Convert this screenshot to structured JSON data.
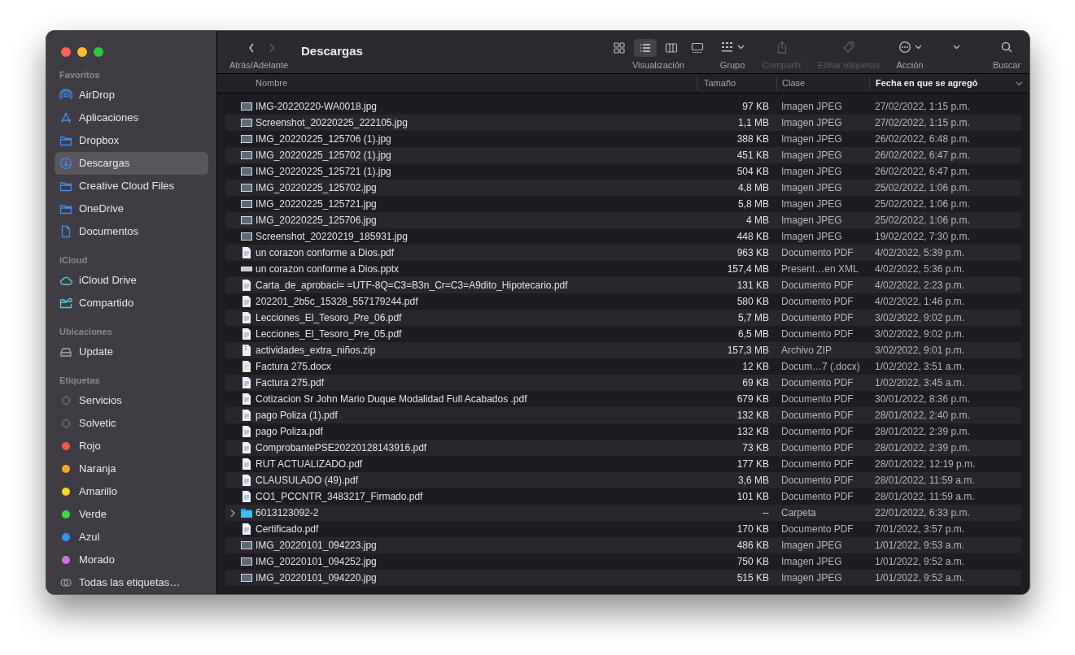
{
  "window": {
    "title": "Descargas"
  },
  "toolbar": {
    "back": {
      "disabled": false
    },
    "forward": {
      "disabled": true
    },
    "nav_label": "Atrás/Adelante",
    "views": [
      {
        "kind": "icons",
        "selected": false
      },
      {
        "kind": "list",
        "selected": true
      },
      {
        "kind": "columns",
        "selected": false
      },
      {
        "kind": "gallery",
        "selected": false
      }
    ],
    "views_label": "Visualización",
    "actions": [
      {
        "kind": "group",
        "label": "Grupo",
        "disabled": false
      },
      {
        "kind": "share",
        "label": "Compartir",
        "disabled": true
      },
      {
        "kind": "tags",
        "label": "Editar etiquetas",
        "disabled": true
      },
      {
        "kind": "action",
        "label": "Acción",
        "disabled": false
      },
      {
        "kind": "more",
        "disabled": false
      },
      {
        "kind": "search",
        "label": "Buscar",
        "disabled": false
      }
    ]
  },
  "sidebar": {
    "sections": [
      {
        "title": "Favoritos",
        "items": [
          {
            "kind": "airdrop",
            "label": "AirDrop",
            "selected": false
          },
          {
            "kind": "apps",
            "label": "Aplicaciones",
            "selected": false
          },
          {
            "kind": "folder",
            "label": "Dropbox",
            "selected": false
          },
          {
            "kind": "download",
            "label": "Descargas",
            "selected": true
          },
          {
            "kind": "folder",
            "label": "Creative Cloud Files",
            "selected": false
          },
          {
            "kind": "folder",
            "label": "OneDrive",
            "selected": false
          },
          {
            "kind": "document",
            "label": "Documentos",
            "selected": false
          }
        ]
      },
      {
        "title": "iCloud",
        "items": [
          {
            "kind": "cloud",
            "label": "iCloud Drive",
            "selected": false
          },
          {
            "kind": "shared",
            "label": "Compartido",
            "selected": false
          }
        ]
      },
      {
        "title": "Ubicaciones",
        "items": [
          {
            "kind": "drive",
            "label": "Update",
            "selected": false
          }
        ]
      },
      {
        "title": "Etiquetas",
        "items": [
          {
            "kind": "tag",
            "label": "Servicios",
            "selected": false
          },
          {
            "kind": "tag",
            "label": "Solvetic",
            "selected": false
          },
          {
            "kind": "tag",
            "label": "Rojo",
            "selected": false,
            "color": "#f2574f"
          },
          {
            "kind": "tag",
            "label": "Naranja",
            "selected": false,
            "color": "#f6a623"
          },
          {
            "kind": "tag",
            "label": "Amarillo",
            "selected": false,
            "color": "#f6d827"
          },
          {
            "kind": "tag",
            "label": "Verde",
            "selected": false,
            "color": "#3ed24e"
          },
          {
            "kind": "tag",
            "label": "Azul",
            "selected": false,
            "color": "#2f94f8"
          },
          {
            "kind": "tag",
            "label": "Morado",
            "selected": false,
            "color": "#cf6ee4"
          },
          {
            "kind": "all-tags",
            "label": "Todas las etiquetas…",
            "selected": false
          }
        ]
      }
    ]
  },
  "table": {
    "columns": [
      {
        "label": "Nombre",
        "sorted": false
      },
      {
        "label": "Tamaño",
        "sorted": false
      },
      {
        "label": "Clase",
        "sorted": false
      },
      {
        "label": "Fecha en que se agregó",
        "sorted": true
      }
    ],
    "rows": [
      {
        "kind": "image",
        "name": "IMG-20220220-WA0018.jpg",
        "size": "97 KB",
        "type": "Imagen JPEG",
        "date": "27/02/2022, 1:15 p.m."
      },
      {
        "kind": "image",
        "name": "Screenshot_20220225_222105.jpg",
        "size": "1,1 MB",
        "type": "Imagen JPEG",
        "date": "27/02/2022, 1:15 p.m."
      },
      {
        "kind": "image",
        "name": "IMG_20220225_125706 (1).jpg",
        "size": "388 KB",
        "type": "Imagen JPEG",
        "date": "26/02/2022, 6:48 p.m."
      },
      {
        "kind": "image",
        "name": "IMG_20220225_125702 (1).jpg",
        "size": "451 KB",
        "type": "Imagen JPEG",
        "date": "26/02/2022, 6:47 p.m."
      },
      {
        "kind": "image",
        "name": "IMG_20220225_125721 (1).jpg",
        "size": "504 KB",
        "type": "Imagen JPEG",
        "date": "26/02/2022, 6:47 p.m."
      },
      {
        "kind": "image",
        "name": "IMG_20220225_125702.jpg",
        "size": "4,8 MB",
        "type": "Imagen JPEG",
        "date": "25/02/2022, 1:06 p.m."
      },
      {
        "kind": "image",
        "name": "IMG_20220225_125721.jpg",
        "size": "5,8 MB",
        "type": "Imagen JPEG",
        "date": "25/02/2022, 1:06 p.m."
      },
      {
        "kind": "image",
        "name": "IMG_20220225_125706.jpg",
        "size": "4 MB",
        "type": "Imagen JPEG",
        "date": "25/02/2022, 1:06 p.m."
      },
      {
        "kind": "image",
        "name": "Screenshot_20220219_185931.jpg",
        "size": "448 KB",
        "type": "Imagen JPEG",
        "date": "19/02/2022, 7:30 p.m."
      },
      {
        "kind": "pdf",
        "name": "un corazon conforme a Dios.pdf",
        "size": "963 KB",
        "type": "Documento PDF",
        "date": "4/02/2022, 5:39 p.m."
      },
      {
        "kind": "slides",
        "name": "un corazon conforme a Dios.pptx",
        "size": "157,4 MB",
        "type": "Present…en XML",
        "date": "4/02/2022, 5:36 p.m."
      },
      {
        "kind": "pdf",
        "name": "Carta_de_aprobaci= =UTF-8Q=C3=B3n_Cr=C3=A9dito_Hipotecario.pdf",
        "size": "131 KB",
        "type": "Documento PDF",
        "date": "4/02/2022, 2:23 p.m."
      },
      {
        "kind": "pdf",
        "name": "202201_2b5c_15328_557179244.pdf",
        "size": "580 KB",
        "type": "Documento PDF",
        "date": "4/02/2022, 1:46 p.m."
      },
      {
        "kind": "pdf",
        "name": "Lecciones_El_Tesoro_Pre_06.pdf",
        "size": "5,7 MB",
        "type": "Documento PDF",
        "date": "3/02/2022, 9:02 p.m."
      },
      {
        "kind": "pdf",
        "name": "Lecciones_El_Tesoro_Pre_05.pdf",
        "size": "6,5 MB",
        "type": "Documento PDF",
        "date": "3/02/2022, 9:02 p.m."
      },
      {
        "kind": "zip",
        "name": "actividades_extra_niños.zip",
        "size": "157,3 MB",
        "type": "Archivo ZIP",
        "date": "3/02/2022, 9:01 p.m."
      },
      {
        "kind": "doc",
        "name": "Factura 275.docx",
        "size": "12 KB",
        "type": "Docum…7 (.docx)",
        "date": "1/02/2022, 3:51 a.m."
      },
      {
        "kind": "pdf",
        "name": "Factura 275.pdf",
        "size": "69 KB",
        "type": "Documento PDF",
        "date": "1/02/2022, 3:45 a.m."
      },
      {
        "kind": "pdf",
        "name": "Cotizacion Sr John Mario Duque Modalidad Full Acabados .pdf",
        "size": "679 KB",
        "type": "Documento PDF",
        "date": "30/01/2022, 8:36 p.m."
      },
      {
        "kind": "pdf",
        "name": "pago Poliza (1).pdf",
        "size": "132 KB",
        "type": "Documento PDF",
        "date": "28/01/2022, 2:40 p.m."
      },
      {
        "kind": "pdf",
        "name": "pago Poliza.pdf",
        "size": "132 KB",
        "type": "Documento PDF",
        "date": "28/01/2022, 2:39 p.m."
      },
      {
        "kind": "pdf",
        "name": "ComprobantePSE20220128143916.pdf",
        "size": "73 KB",
        "type": "Documento PDF",
        "date": "28/01/2022, 2:39 p.m."
      },
      {
        "kind": "pdf",
        "name": "RUT ACTUALIZADO.pdf",
        "size": "177 KB",
        "type": "Documento PDF",
        "date": "28/01/2022, 12:19 p.m."
      },
      {
        "kind": "pdf",
        "name": "CLAUSULADO (49).pdf",
        "size": "3,6 MB",
        "type": "Documento PDF",
        "date": "28/01/2022, 11:59 a.m."
      },
      {
        "kind": "pdf",
        "name": "CO1_PCCNTR_3483217_Firmado.pdf",
        "size": "101 KB",
        "type": "Documento PDF",
        "date": "28/01/2022, 11:59 a.m."
      },
      {
        "kind": "folder",
        "name": "6013123092-2",
        "size": "--",
        "type": "Carpeta",
        "date": "22/01/2022, 6:33 p.m.",
        "expanded": false
      },
      {
        "kind": "pdf",
        "name": "Certificado.pdf",
        "size": "170 KB",
        "type": "Documento PDF",
        "date": "7/01/2022, 3:57 p.m."
      },
      {
        "kind": "image",
        "name": "IMG_20220101_094223.jpg",
        "size": "486 KB",
        "type": "Imagen JPEG",
        "date": "1/01/2022, 9:53 a.m."
      },
      {
        "kind": "image",
        "name": "IMG_20220101_094252.jpg",
        "size": "750 KB",
        "type": "Imagen JPEG",
        "date": "1/01/2022, 9:52 a.m."
      },
      {
        "kind": "image",
        "name": "IMG_20220101_094220.jpg",
        "size": "515 KB",
        "type": "Imagen JPEG",
        "date": "1/01/2022, 9:52 a.m."
      }
    ]
  }
}
